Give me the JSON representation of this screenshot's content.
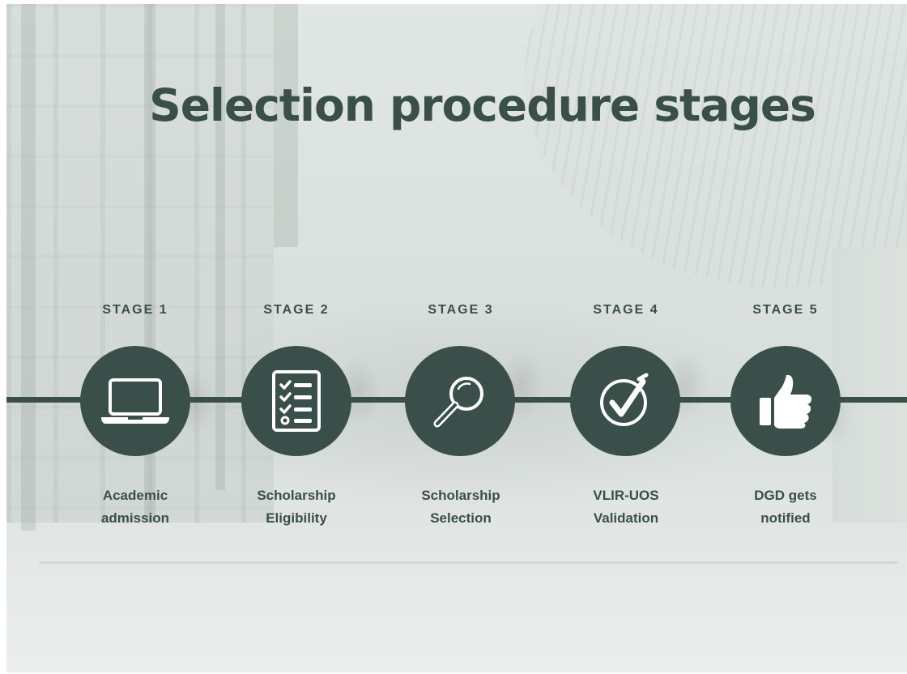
{
  "slide": {
    "title": "Selection procedure stages",
    "colors": {
      "accent": "#3b4f4a",
      "background": "#dfe6e3",
      "icon": "#ffffff"
    },
    "stages": [
      {
        "label": "STAGE 1",
        "icon": "laptop-icon",
        "description_lines": [
          "Academic",
          "admission"
        ]
      },
      {
        "label": "STAGE 2",
        "icon": "checklist-icon",
        "description_lines": [
          "Scholarship",
          "Eligibility"
        ]
      },
      {
        "label": "STAGE 3",
        "icon": "magnifier-icon",
        "description_lines": [
          "Scholarship",
          "Selection"
        ]
      },
      {
        "label": "STAGE 4",
        "icon": "checkmark-circle-icon",
        "description_lines": [
          "VLIR-UOS",
          "Validation"
        ]
      },
      {
        "label": "STAGE 5",
        "icon": "thumbs-up-icon",
        "description_lines": [
          "DGD gets",
          "notified"
        ]
      }
    ]
  }
}
